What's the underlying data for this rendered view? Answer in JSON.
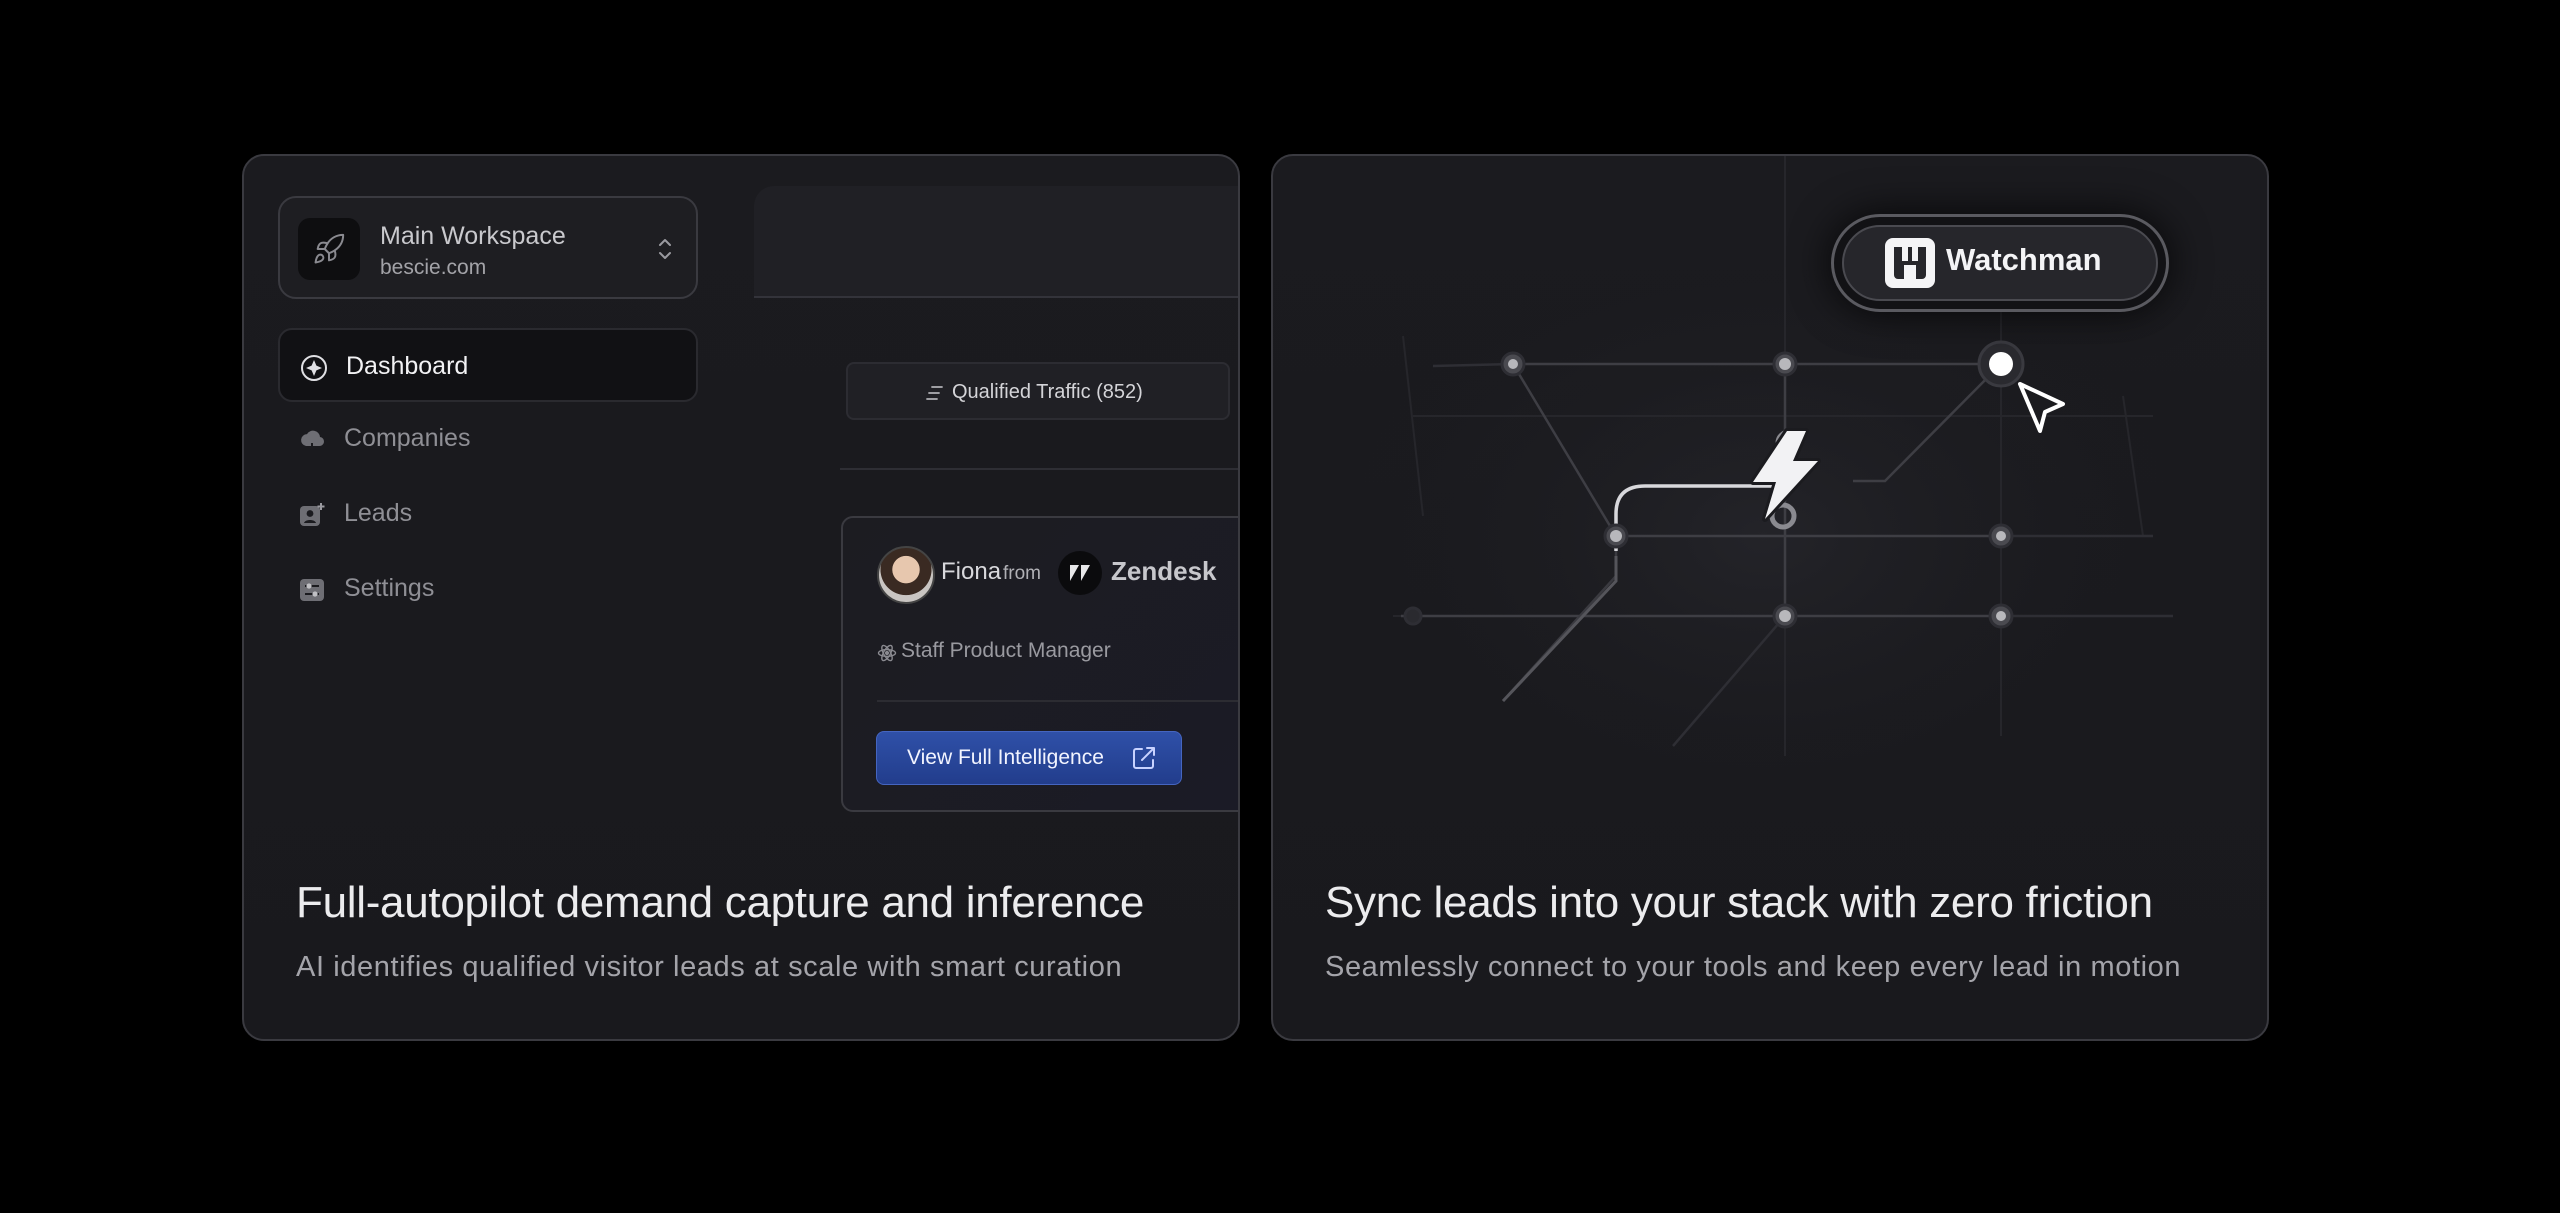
{
  "left_card": {
    "workspace": {
      "name": "Main Workspace",
      "domain": "bescie.com"
    },
    "nav": [
      {
        "label": "Dashboard",
        "active": true
      },
      {
        "label": "Companies",
        "active": false
      },
      {
        "label": "Leads",
        "active": false
      },
      {
        "label": "Settings",
        "active": false
      }
    ],
    "tab": {
      "label": "Qualified Traffic (852)"
    },
    "lead": {
      "name": "Fiona",
      "from": "from",
      "company": "Zendesk",
      "role": "Staff Product Manager",
      "button": "View Full Intelligence"
    },
    "heading": "Full-autopilot demand capture and inference",
    "subheading": "AI identifies qualified visitor leads at scale with smart curation"
  },
  "right_card": {
    "brand": "Watchman",
    "heading": "Sync leads into your stack with zero friction",
    "subheading": "Seamlessly connect to your tools and keep every lead in motion"
  },
  "colors": {
    "background": "#000000",
    "card": "#1b1b1f",
    "border": "#3a3a40",
    "button": "#2a47a0"
  }
}
